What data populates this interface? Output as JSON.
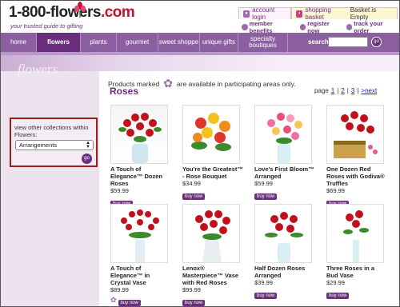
{
  "header": {
    "logo_main": "1-800-flowers",
    "logo_suffix": ".com",
    "tagline": "your trusted guide to gifting",
    "account_login": "account login",
    "shopping_basket": "shopping basket",
    "basket_status": "Basket is Empty",
    "member_benefits": "member benefits",
    "register_now": "register now",
    "track_order": "track your order"
  },
  "nav": {
    "items": [
      {
        "label": "home"
      },
      {
        "label": "flowers"
      },
      {
        "label": "plants"
      },
      {
        "label": "gourmet"
      },
      {
        "label": "sweet shoppe"
      },
      {
        "label": "unique gifts"
      },
      {
        "label": "specialty boutiques"
      }
    ],
    "search_label": "search:",
    "go": "go"
  },
  "banner": {
    "title": "flowers"
  },
  "sidebar": {
    "collections_label": "view other collections within Flowers:",
    "select_value": "Arrangements",
    "go": "go"
  },
  "main": {
    "notice_before": "Products marked",
    "notice_after": "are available in participating areas only.",
    "section_title": "Roses",
    "pager": {
      "label": "page",
      "pages": [
        "1",
        "2",
        "3"
      ],
      "next": ">next"
    },
    "buy_label": "buy now",
    "products": [
      {
        "name": "A Touch of Elegance™ Dozen Roses",
        "price": "$59.99"
      },
      {
        "name": "You're the Greatest™ - Rose Bouquet",
        "price": "$34.99"
      },
      {
        "name": "Love's First Bloom™ Arranged",
        "price": "$59.99"
      },
      {
        "name": "One Dozen Red Roses with Godiva® Truffles",
        "price": "$69.99"
      },
      {
        "name": "A Touch of Elegance™ in Crystal Vase",
        "price": "$89.99"
      },
      {
        "name": "Lenox® Masterpiece™ Vase with Red Roses",
        "price": "$99.99"
      },
      {
        "name": "Half Dozen Roses Arranged",
        "price": "$39.99"
      },
      {
        "name": "Three Roses in a Bud Vase",
        "price": "$29.99"
      }
    ]
  },
  "colors": {
    "brand_purple": "#6a2f7c",
    "nav_purple": "#8c5fa0",
    "highlight_red": "#9c1b1b"
  }
}
